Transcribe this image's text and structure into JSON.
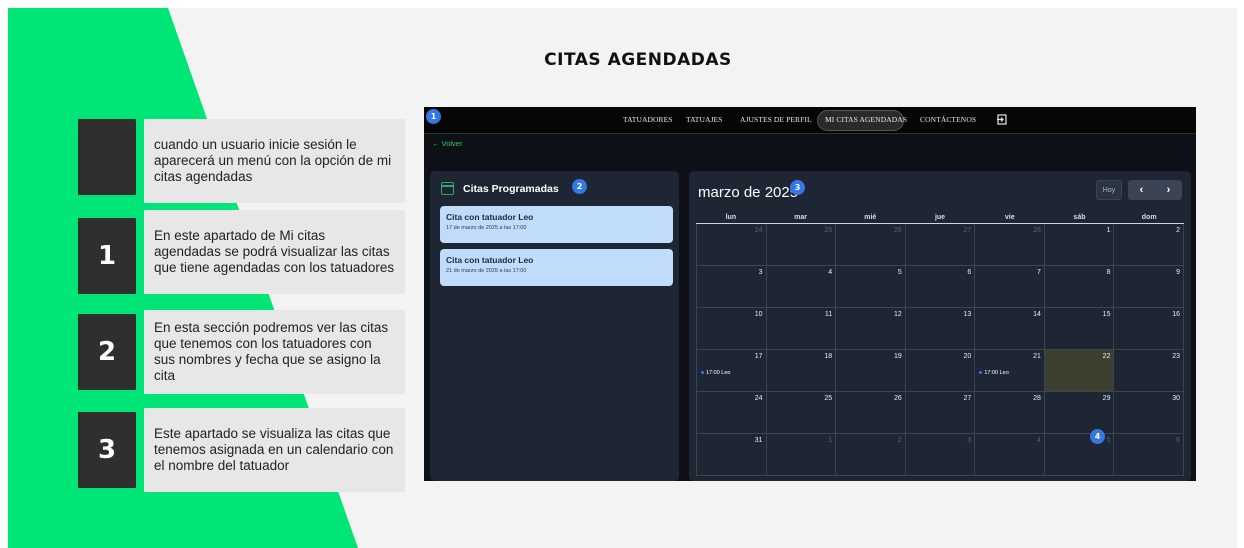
{
  "title": "CITAS AGENDADAS",
  "steps": [
    {
      "number": "",
      "text": "cuando un usuario inicie sesión le aparecerá un menú con la opción de mi citas agendadas"
    },
    {
      "number": "1",
      "text": "En este apartado de Mi citas agendadas se podrá visualizar las citas que tiene agendadas con los tatuadores"
    },
    {
      "number": "2",
      "text": "En esta sección podremos ver las citas que tenemos con los tatuadores con sus nombres y fecha que se asigno la cita"
    },
    {
      "number": "3",
      "text": "Este apartado se visualiza las citas que tenemos asignada en un calendario con el nombre del tatuador"
    }
  ],
  "colors": {
    "accent_green": "#00e676",
    "badge_blue": "#3578e5",
    "app_bg": "#0d1117"
  },
  "app": {
    "nav": {
      "items": [
        "TATUADORES",
        "TATUAJES",
        "AJUSTES DE PERFIL",
        "MI CITAS AGENDADAS",
        "CONTÁCTENOS"
      ],
      "active": "MI CITAS AGENDADAS",
      "exit_icon": "logout-icon"
    },
    "back_label": "Volver",
    "badges": [
      "1",
      "2",
      "3",
      "4"
    ],
    "appointments_panel": {
      "title": "Citas Programadas",
      "items": [
        {
          "title": "Cita con tatuador Leo",
          "date": "17 de marzo de 2025 a las 17:00"
        },
        {
          "title": "Cita con tatuador Leo",
          "date": "21 de marzo de 2025 a las 17:00"
        }
      ]
    },
    "calendar": {
      "month_label": "marzo de 2025",
      "today_button": "Hoy",
      "prev_label": "‹",
      "next_label": "›",
      "weekdays": [
        "lun",
        "mar",
        "mié",
        "jue",
        "vie",
        "sáb",
        "dom"
      ],
      "weeks": [
        [
          {
            "d": "24",
            "o": true
          },
          {
            "d": "25",
            "o": true
          },
          {
            "d": "26",
            "o": true
          },
          {
            "d": "27",
            "o": true
          },
          {
            "d": "28",
            "o": true
          },
          {
            "d": "1"
          },
          {
            "d": "2"
          }
        ],
        [
          {
            "d": "3"
          },
          {
            "d": "4"
          },
          {
            "d": "5"
          },
          {
            "d": "6"
          },
          {
            "d": "7"
          },
          {
            "d": "8"
          },
          {
            "d": "9"
          }
        ],
        [
          {
            "d": "10"
          },
          {
            "d": "11"
          },
          {
            "d": "12"
          },
          {
            "d": "13"
          },
          {
            "d": "14"
          },
          {
            "d": "15"
          },
          {
            "d": "16"
          }
        ],
        [
          {
            "d": "17",
            "e": "17:00 Leo"
          },
          {
            "d": "18"
          },
          {
            "d": "19"
          },
          {
            "d": "20"
          },
          {
            "d": "21",
            "e": "17:00 Leo"
          },
          {
            "d": "22",
            "today": true
          },
          {
            "d": "23"
          }
        ],
        [
          {
            "d": "24"
          },
          {
            "d": "25"
          },
          {
            "d": "26"
          },
          {
            "d": "27"
          },
          {
            "d": "28"
          },
          {
            "d": "29"
          },
          {
            "d": "30"
          }
        ],
        [
          {
            "d": "31"
          },
          {
            "d": "1",
            "o": true
          },
          {
            "d": "2",
            "o": true
          },
          {
            "d": "3",
            "o": true
          },
          {
            "d": "4",
            "o": true
          },
          {
            "d": "5",
            "o": true
          },
          {
            "d": "6",
            "o": true
          }
        ]
      ]
    }
  }
}
